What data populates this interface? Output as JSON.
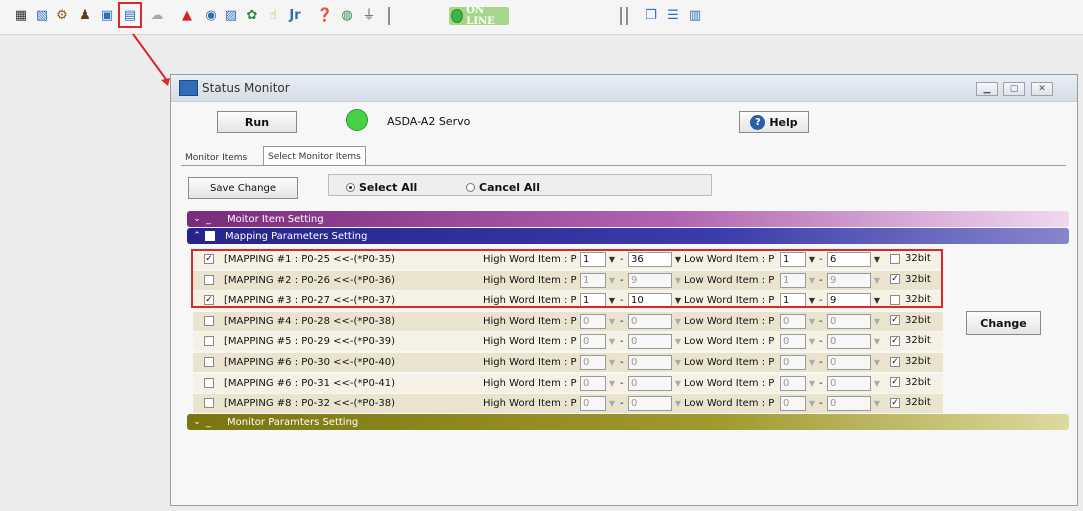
{
  "toolbar": {
    "icons": [
      "tree-icon",
      "chart-icon",
      "tools-icon",
      "user-icon",
      "monitor-icon",
      "cloud-icon",
      "warning-icon",
      "gauge-icon",
      "scope-icon",
      "globe-icon",
      "hand-icon",
      "jr-icon",
      "help-icon",
      "wizard-icon",
      "plug-icon"
    ],
    "online_label": "ON LINE"
  },
  "window": {
    "title": "Status Monitor",
    "run_label": "Run",
    "model": "ASDA-A2 Servo",
    "help_label": "Help",
    "tabs": [
      "Monitor Items",
      "Select Monitor Items"
    ],
    "save_label": "Save Change",
    "select_all_label": "Select All",
    "cancel_all_label": "Cancel All",
    "band1_label": "Moitor Item Setting",
    "band2_label": "Mapping Parameters Setting",
    "band3_label": "Monitor Paramters Setting",
    "change_label": "Change",
    "high_label": "High Word Item : P",
    "low_label": "Low Word Item : P",
    "bit_label": "32bit",
    "dash": "-"
  },
  "rows": [
    {
      "label": "[MAPPING #1 : P0-25 <<-(*P0-35)",
      "checked": true,
      "h1": "1",
      "h2": "36",
      "l1": "1",
      "l2": "6",
      "b32": false,
      "enabled": true
    },
    {
      "label": "[MAPPING #2 : P0-26 <<-(*P0-36)",
      "checked": false,
      "h1": "1",
      "h2": "9",
      "l1": "1",
      "l2": "9",
      "b32": true,
      "enabled": false
    },
    {
      "label": "[MAPPING #3 : P0-27 <<-(*P0-37)",
      "checked": true,
      "h1": "1",
      "h2": "10",
      "l1": "1",
      "l2": "9",
      "b32": false,
      "enabled": true
    },
    {
      "label": "[MAPPING #4 : P0-28 <<-(*P0-38)",
      "checked": false,
      "h1": "0",
      "h2": "0",
      "l1": "0",
      "l2": "0",
      "b32": true,
      "enabled": false
    },
    {
      "label": "[MAPPING #5 : P0-29 <<-(*P0-39)",
      "checked": false,
      "h1": "0",
      "h2": "0",
      "l1": "0",
      "l2": "0",
      "b32": true,
      "enabled": false
    },
    {
      "label": "[MAPPING #6 : P0-30 <<-(*P0-40)",
      "checked": false,
      "h1": "0",
      "h2": "0",
      "l1": "0",
      "l2": "0",
      "b32": true,
      "enabled": false
    },
    {
      "label": "[MAPPING #6 : P0-31 <<-(*P0-41)",
      "checked": false,
      "h1": "0",
      "h2": "0",
      "l1": "0",
      "l2": "0",
      "b32": true,
      "enabled": false
    },
    {
      "label": "[MAPPING #8 : P0-32 <<-(*P0-38)",
      "checked": false,
      "h1": "0",
      "h2": "0",
      "l1": "0",
      "l2": "0",
      "b32": true,
      "enabled": false
    }
  ]
}
